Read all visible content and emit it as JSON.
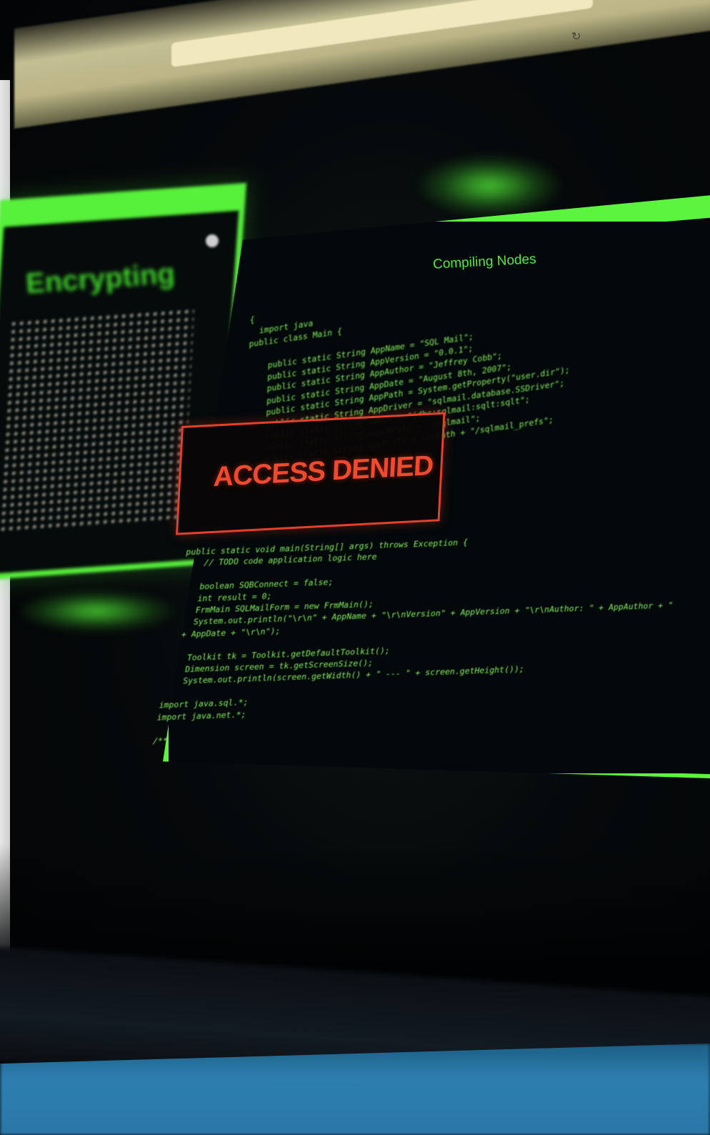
{
  "browser": {
    "address": "",
    "reload_icon": "reload-icon"
  },
  "left_panel": {
    "title": "Encrypting"
  },
  "main_panel": {
    "title": "Compiling Nodes",
    "code_top": [
      "{",
      "  import java",
      "public class Main {",
      "",
      "    public static String AppName = \"SQL Mail\";",
      "    public static String AppVersion = \"0.0.1\";",
      "    public static String AppAuthor = \"Jeffrey Cobb\";",
      "    public static String AppDate = \"August 8th, 2007\";",
      "    public static String AppPath = System.getProperty(\"user.dir\");",
      "    public static String AppDriver = \"sqlmail.database.SSDriver\";",
      "    public static String AppDB = \"jdbc:sqlmail:sqlt:sqlt\";",
      "    public static String AppDBPath = \"/sqlmail\";",
      "    public static String AppPrefs = AppPath + \"/sqlmail_prefs\";"
    ],
    "code_bottom": [
      "public static void main(String[] args) throws Exception {",
      "    // TODO code application logic here",
      "",
      "    boolean SQBConnect = false;",
      "    int result = 0;",
      "    FrmMain SQLMailForm = new FrmMain();",
      "    System.out.println(\"\\r\\n\" + AppName + \"\\r\\nVersion\" + AppVersion + \"\\r\\nAuthor: \" + AppAuthor + \"",
      "  + AppDate + \"\\r\\n\");",
      "",
      "    Toolkit tk = Toolkit.getDefaultToolkit();",
      "    Dimension screen = tk.getScreenSize();",
      "    System.out.println(screen.getWidth() + \" --- \" + screen.getHeight());",
      "",
      "import java.sql.*;",
      "import java.net.*;",
      "",
      "/**"
    ]
  },
  "alert": {
    "message": "ACCESS DENIED"
  },
  "colors": {
    "terminal_green": "#5cf43f",
    "code_text": "#86f25c",
    "alert_red": "#f04a2e",
    "desk_blue": "#2d7fb0"
  }
}
